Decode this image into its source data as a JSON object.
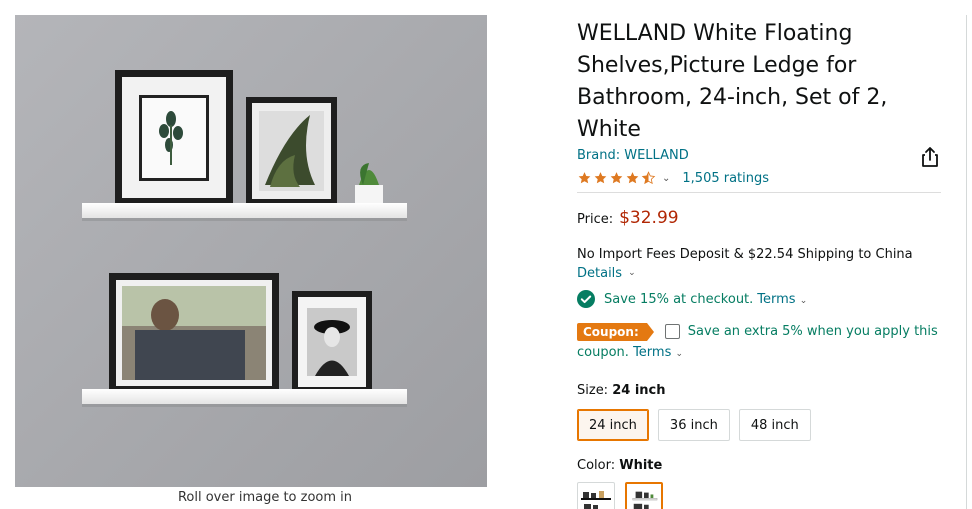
{
  "product": {
    "title": "WELLAND White Floating Shelves,Picture Ledge for Bathroom, 24-inch, Set of 2, White",
    "brand_label": "Brand: WELLAND",
    "rating_stars": 4.5,
    "ratings_count": "1,505 ratings"
  },
  "gallery": {
    "zoom_hint": "Roll over image to zoom in"
  },
  "price": {
    "label": "Price:",
    "value": "$32.99",
    "color": "#B12704"
  },
  "shipping": {
    "text": "No Import Fees Deposit & $22.54 Shipping to China",
    "details_label": "Details"
  },
  "promo": {
    "save_text": "Save 15% at checkout.",
    "terms_label": "Terms"
  },
  "coupon": {
    "badge": "Coupon:",
    "text": "Save an extra 5% when you apply this coupon.",
    "terms_label": "Terms",
    "checked": false
  },
  "size": {
    "label": "Size:",
    "selected": "24 inch",
    "options": [
      "24 inch",
      "36 inch",
      "48 inch"
    ]
  },
  "color": {
    "label": "Color:",
    "selected": "White"
  },
  "colors": {
    "link": "#007185",
    "green": "#067D62",
    "accent": "#E77600",
    "star": "#DE7921",
    "coupon": "#E47911"
  }
}
